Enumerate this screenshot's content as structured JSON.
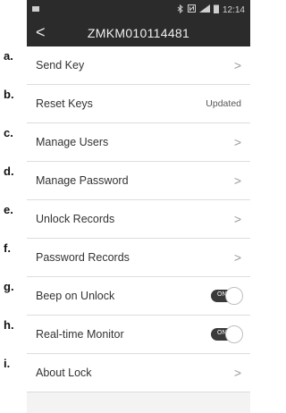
{
  "status_bar": {
    "time": "12:14",
    "icons": [
      "bluetooth-icon",
      "nfc-icon",
      "signal-icon",
      "battery-icon"
    ]
  },
  "header": {
    "back_symbol": "<",
    "title": "ZMKM010114481"
  },
  "rows": [
    {
      "letter": "a.",
      "label": "Send Key",
      "right_type": "chevron",
      "right": ">"
    },
    {
      "letter": "b.",
      "label": "Reset Keys",
      "right_type": "text",
      "right": "Updated"
    },
    {
      "letter": "c.",
      "label": "Manage Users",
      "right_type": "chevron",
      "right": ">"
    },
    {
      "letter": "d.",
      "label": "Manage Password",
      "right_type": "chevron",
      "right": ">"
    },
    {
      "letter": "e.",
      "label": "Unlock Records",
      "right_type": "chevron",
      "right": ">"
    },
    {
      "letter": "f.",
      "label": "Password Records",
      "right_type": "chevron",
      "right": ">"
    },
    {
      "letter": "g.",
      "label": "Beep on Unlock",
      "right_type": "toggle",
      "right": "ON"
    },
    {
      "letter": "h.",
      "label": "Real-time Monitor",
      "right_type": "toggle",
      "right": "ON"
    },
    {
      "letter": "i.",
      "label": "About Lock",
      "right_type": "chevron",
      "right": ">"
    }
  ]
}
